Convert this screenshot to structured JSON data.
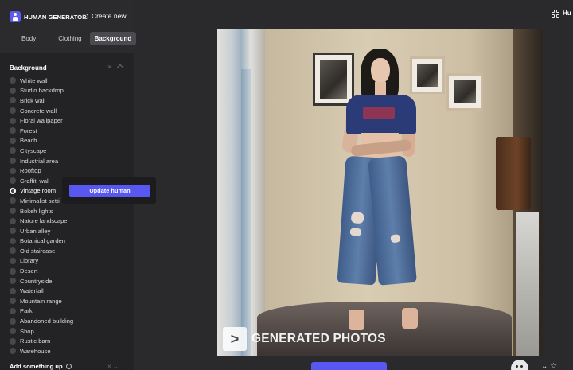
{
  "app": {
    "brand": "HUMAN GENERATOR",
    "create_new": "Create new",
    "top_right_label": "Hu"
  },
  "tabs": [
    {
      "label": "Body",
      "active": false
    },
    {
      "label": "Clothing",
      "active": false
    },
    {
      "label": "Background",
      "active": true
    }
  ],
  "section": {
    "title": "Background",
    "close": "×"
  },
  "options": [
    {
      "label": "White wall",
      "selected": false
    },
    {
      "label": "Studio backdrop",
      "selected": false
    },
    {
      "label": "Brick wall",
      "selected": false
    },
    {
      "label": "Concrete wall",
      "selected": false
    },
    {
      "label": "Floral wallpaper",
      "selected": false
    },
    {
      "label": "Forest",
      "selected": false
    },
    {
      "label": "Beach",
      "selected": false
    },
    {
      "label": "Cityscape",
      "selected": false
    },
    {
      "label": "Industrial area",
      "selected": false
    },
    {
      "label": "Rooftop",
      "selected": false
    },
    {
      "label": "Graffiti wall",
      "selected": false
    },
    {
      "label": "Vintage room",
      "selected": true
    },
    {
      "label": "Minimalist setti",
      "selected": false
    },
    {
      "label": "Bokeh lights",
      "selected": false
    },
    {
      "label": "Nature landscape",
      "selected": false
    },
    {
      "label": "Urban alley",
      "selected": false
    },
    {
      "label": "Botanical garden",
      "selected": false
    },
    {
      "label": "Old staircase",
      "selected": false
    },
    {
      "label": "Library",
      "selected": false
    },
    {
      "label": "Desert",
      "selected": false
    },
    {
      "label": "Countryside",
      "selected": false
    },
    {
      "label": "Waterfall",
      "selected": false
    },
    {
      "label": "Mountain range",
      "selected": false
    },
    {
      "label": "Park",
      "selected": false
    },
    {
      "label": "Abandoned building",
      "selected": false
    },
    {
      "label": "Shop",
      "selected": false
    },
    {
      "label": "Rustic barn",
      "selected": false
    },
    {
      "label": "Warehouse",
      "selected": false
    }
  ],
  "popover": {
    "update_label": "Update human"
  },
  "bottom_section": {
    "title": "Add something up"
  },
  "image": {
    "watermark_box": ">",
    "watermark_text": "GENERATED PHOTOS"
  },
  "icons": {
    "logo": "human-generator-logo-icon",
    "create_new": "ring-icon",
    "grid": "grid-icon",
    "close": "close-icon",
    "caret": "chevron-up-icon",
    "info": "info-icon"
  },
  "colors": {
    "accent": "#5957f2",
    "sidebar_bg": "#232325",
    "app_bg": "#2a2a2c"
  }
}
